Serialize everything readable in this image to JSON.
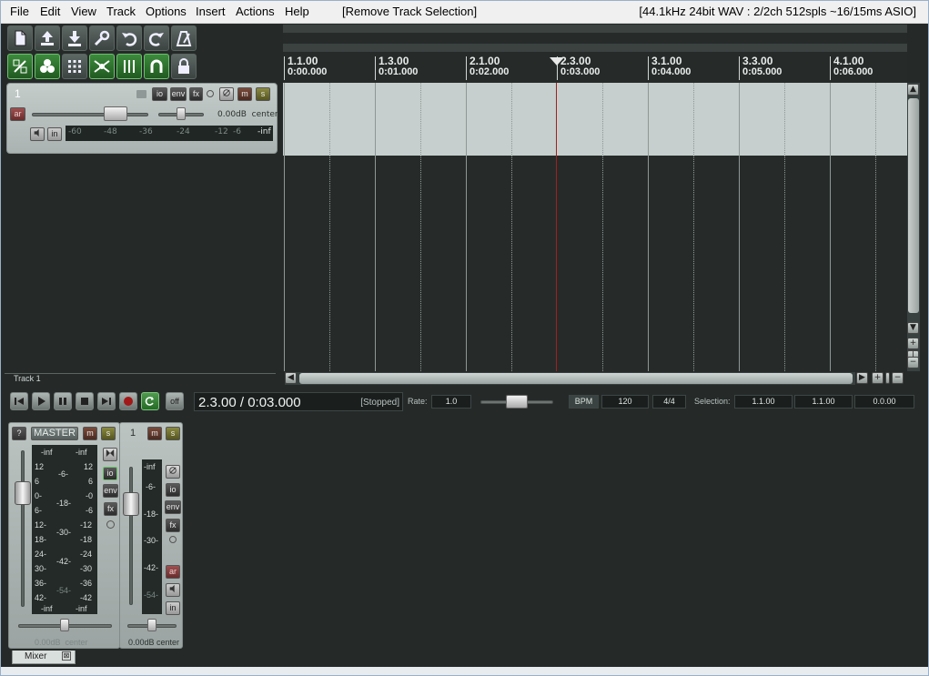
{
  "menu": {
    "items": [
      "File",
      "Edit",
      "View",
      "Track",
      "Options",
      "Insert",
      "Actions",
      "Help",
      "[Remove Track Selection]"
    ],
    "status": "[44.1kHz 24bit WAV : 2/2ch 512spls ~16/15ms ASIO]"
  },
  "toolbar": {
    "row1": [
      "new-project-icon",
      "open-project-icon",
      "save-project-icon",
      "settings-wrench-icon",
      "undo-icon",
      "redo-icon",
      "metronome-icon"
    ],
    "row2": [
      "snap-icon",
      "ripple-edit-icon",
      "grid-icon",
      "auto-crossfade-icon",
      "envelope-lock-icon",
      "loop-icon",
      "lock-icon"
    ]
  },
  "track": {
    "number": "1",
    "name": "Track 1",
    "buttons": {
      "io": "io",
      "env": "env",
      "fx": "fx",
      "mute": "m",
      "solo": "s",
      "arm": "ar",
      "in": "in"
    },
    "volume_pan": "0.00dB  center",
    "meter_labels": [
      "-60",
      "-48",
      "-36",
      "-24",
      "-12",
      "-6",
      "-inf"
    ]
  },
  "ruler": {
    "marks": [
      {
        "bar": "1.1.00",
        "time": "0:00.000"
      },
      {
        "bar": "1.3.00",
        "time": "0:01.000"
      },
      {
        "bar": "2.1.00",
        "time": "0:02.000"
      },
      {
        "bar": "2.3.00",
        "time": "0:03.000"
      },
      {
        "bar": "3.1.00",
        "time": "0:04.000"
      },
      {
        "bar": "3.3.00",
        "time": "0:05.000"
      },
      {
        "bar": "4.1.00",
        "time": "0:06.000"
      }
    ]
  },
  "transport": {
    "time": "2.3.00 / 0:03.000",
    "state": "[Stopped]",
    "off_label": "off",
    "rate_label": "Rate:",
    "rate": "1.0",
    "bpm_label": "BPM",
    "bpm": "120",
    "time_sig": "4/4",
    "selection_label": "Selection:",
    "sel_start": "1.1.00",
    "sel_end": "1.1.00",
    "sel_len": "0.0.00"
  },
  "mixer": {
    "master": {
      "help": "?",
      "name": "MASTER",
      "mute": "m",
      "solo": "s",
      "peak_l": "-inf",
      "peak_r": "-inf",
      "scale_l": [
        "12",
        "6",
        "0-",
        "6-",
        "12-",
        "18-",
        "24-",
        "30-",
        "36-",
        "42-"
      ],
      "scale_mid": [
        "-6-",
        "-18-",
        "-30-",
        "-42-",
        "-54-"
      ],
      "scale_r": [
        "12",
        "6",
        "-0",
        "-6",
        "-12",
        "-18",
        "-24",
        "-30",
        "-36",
        "-42"
      ],
      "foot_l": "-inf",
      "foot_r": "-inf",
      "io": "io",
      "env": "env",
      "fx": "fx",
      "volume_pan": "0.00dB  center"
    },
    "track": {
      "number": "1",
      "mute": "m",
      "solo": "s",
      "peak": "-inf",
      "scale": [
        "-6-",
        "-18-",
        "-30-",
        "-42-",
        "-54-"
      ],
      "io": "io",
      "env": "env",
      "fx": "fx",
      "arm": "ar",
      "in": "in",
      "volume_pan": "0.00dB center"
    },
    "tab_label": "Mixer",
    "tab_close": "⊠"
  },
  "colors": {
    "background": "#252a29",
    "lane": "#c6cfcd",
    "cursor": "#a02020",
    "accent_green": "#3d8a3d"
  }
}
